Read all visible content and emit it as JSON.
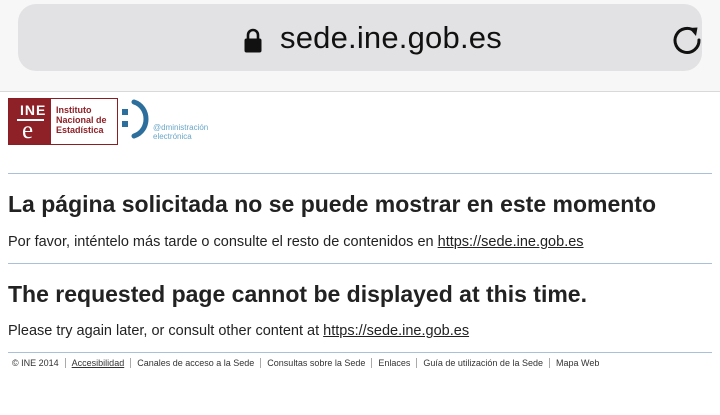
{
  "browser": {
    "url": "sede.ine.gob.es"
  },
  "logo": {
    "ine_letters": "INE",
    "ine_e": "e",
    "name_line1": "Instituto",
    "name_line2": "Nacional de",
    "name_line3": "Estadística",
    "ae_line1": "@dministración",
    "ae_line2": "electrónica"
  },
  "spanish": {
    "heading": "La página solicitada no se puede mostrar en este momento",
    "text": "Por favor, inténtelo más tarde o consulte el resto de contenidos en ",
    "link": "https://sede.ine.gob.es"
  },
  "english": {
    "heading": "The requested page cannot be displayed at this time.",
    "text": "Please try again later, or consult other content at ",
    "link": "https://sede.ine.gob.es"
  },
  "footer": {
    "copyright": "© INE 2014",
    "links": [
      "Accesibilidad",
      "Canales de acceso a la Sede",
      "Consultas sobre la Sede",
      "Enlaces",
      "Guía de utilización de la Sede",
      "Mapa Web"
    ]
  }
}
